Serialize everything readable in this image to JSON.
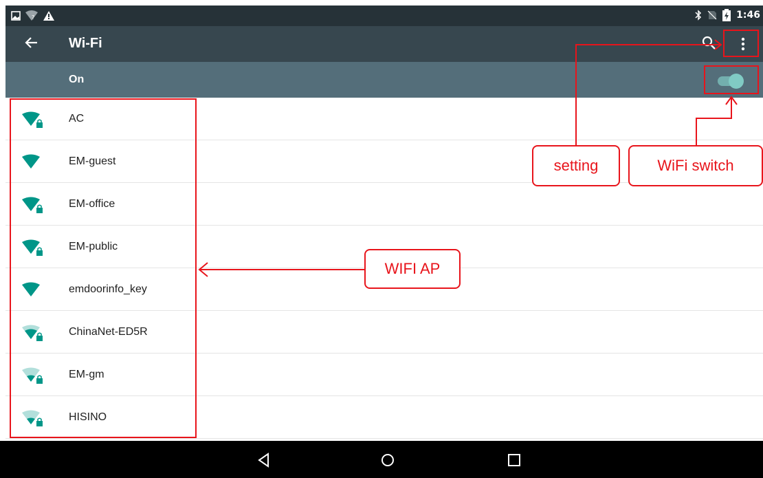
{
  "statusbar": {
    "time": "1:46",
    "icons_left": [
      "image-notification-icon",
      "wifi-no-internet-icon",
      "warning-icon"
    ],
    "icons_right": [
      "bluetooth-icon",
      "no-sim-icon",
      "battery-charging-icon"
    ]
  },
  "toolbar": {
    "title": "Wi-Fi",
    "back_icon": "arrow-back-icon",
    "search_icon": "search-icon",
    "overflow_icon": "more-vert-icon"
  },
  "switchbar": {
    "label": "On",
    "toggle_state": "on"
  },
  "networks": [
    {
      "ssid": "AC",
      "strength": "full",
      "locked": true
    },
    {
      "ssid": "EM-guest",
      "strength": "full",
      "locked": false
    },
    {
      "ssid": "EM-office",
      "strength": "full",
      "locked": true
    },
    {
      "ssid": "EM-public",
      "strength": "full",
      "locked": true
    },
    {
      "ssid": "emdoorinfo_key",
      "strength": "full",
      "locked": false
    },
    {
      "ssid": "ChinaNet-ED5R",
      "strength": "medium",
      "locked": true
    },
    {
      "ssid": "EM-gm",
      "strength": "weak",
      "locked": true
    },
    {
      "ssid": "HISINO",
      "strength": "weak",
      "locked": true
    }
  ],
  "navbar": {
    "back_icon": "nav-back-icon",
    "home_icon": "nav-home-icon",
    "recents_icon": "nav-recents-icon"
  },
  "annotations": {
    "setting": "setting",
    "wifi_switch": "WiFi switch",
    "wifi_ap": "WIFI AP"
  },
  "colors": {
    "statusbar": "#263238",
    "toolbar": "#37474f",
    "switchbar": "#546e7a",
    "accent": "#009688",
    "toggle": "#80cbc4",
    "annotation": "#e8141b"
  }
}
